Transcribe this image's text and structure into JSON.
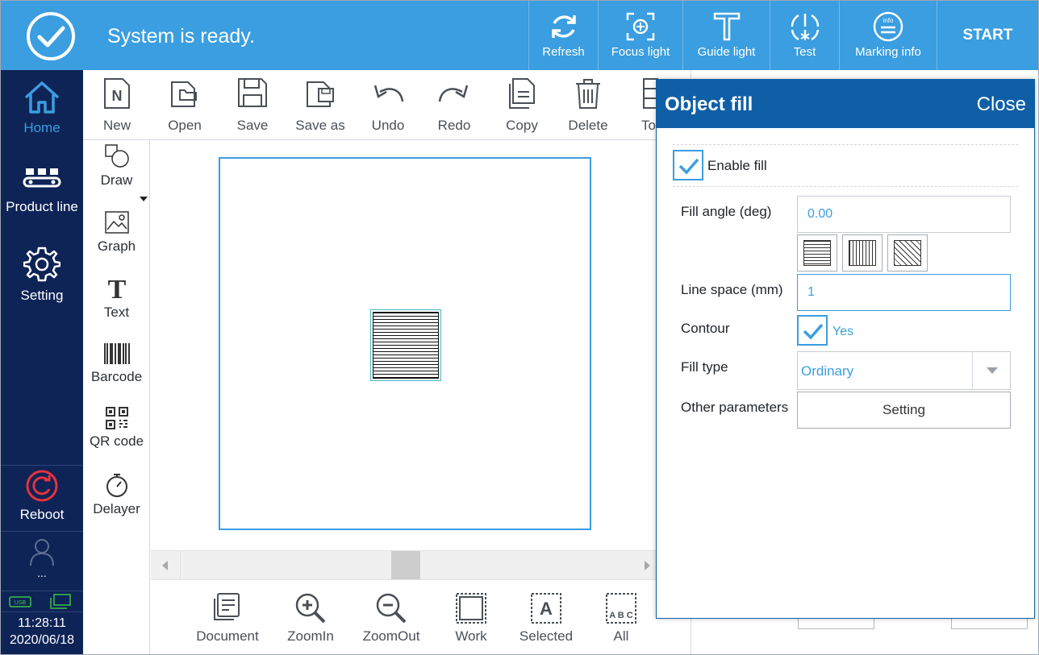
{
  "header": {
    "status": "System is ready.",
    "buttons": [
      {
        "label": "Refresh",
        "icon": "refresh-icon"
      },
      {
        "label": "Focus light",
        "icon": "focus-light-icon"
      },
      {
        "label": "Guide light",
        "icon": "guide-light-icon"
      },
      {
        "label": "Test",
        "icon": "test-icon"
      },
      {
        "label": "Marking info",
        "icon": "marking-info-icon"
      }
    ],
    "start_label": "START",
    "info_badge": "info"
  },
  "nav": {
    "items": [
      {
        "label": "Home",
        "icon": "home-icon"
      },
      {
        "label": "Product line",
        "icon": "product-line-icon"
      },
      {
        "label": "Setting",
        "icon": "gear-icon"
      }
    ],
    "reboot_label": "Reboot",
    "user_label": "...",
    "usb_label": "USB",
    "time": "11:28:11",
    "date": "2020/06/18"
  },
  "toolbar": {
    "items": [
      {
        "label": "New",
        "glyph": "N"
      },
      {
        "label": "Open"
      },
      {
        "label": "Save"
      },
      {
        "label": "Save as"
      },
      {
        "label": "Undo"
      },
      {
        "label": "Redo"
      },
      {
        "label": "Copy"
      },
      {
        "label": "Delete"
      },
      {
        "label": "To"
      }
    ]
  },
  "tools": {
    "items": [
      {
        "label": "Draw"
      },
      {
        "label": "Graph"
      },
      {
        "label": "Text",
        "glyph": "T"
      },
      {
        "label": "Barcode"
      },
      {
        "label": "QR code"
      },
      {
        "label": "Delayer"
      }
    ]
  },
  "bottom": {
    "items": [
      {
        "label": "Document"
      },
      {
        "label": "ZoomIn"
      },
      {
        "label": "ZoomOut"
      },
      {
        "label": "Work"
      },
      {
        "label": "Selected",
        "glyph": "A"
      },
      {
        "label": "All",
        "glyph": "A B C"
      }
    ]
  },
  "dialog": {
    "title": "Object fill",
    "close_label": "Close",
    "enable_fill_label": "Enable fill",
    "enable_fill_checked": true,
    "fill_angle_label": "Fill angle (deg)",
    "fill_angle_value": "0.00",
    "line_space_label": "Line space (mm)",
    "line_space_value": "1",
    "contour_label": "Contour",
    "contour_value": "Yes",
    "contour_checked": true,
    "fill_type_label": "Fill type",
    "fill_type_value": "Ordinary",
    "other_params_label": "Other parameters",
    "other_params_button": "Setting"
  },
  "colors": {
    "header_blue": "#3a9ee0",
    "nav_navy": "#0e2356",
    "dialog_blue": "#0f5fa6",
    "accent_red": "#e8323c",
    "usb_green": "#39c24a"
  }
}
